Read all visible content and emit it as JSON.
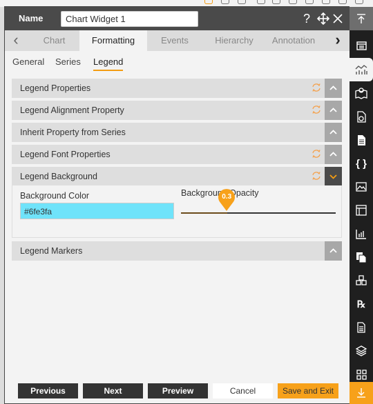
{
  "header": {
    "name_label": "Name",
    "name_value": "Chart Widget 1",
    "help_icon": "help-icon",
    "move_icon": "move-icon",
    "close_icon": "close-icon"
  },
  "tabs": {
    "prev_glyph": "‹",
    "next_glyph": "›",
    "items": [
      {
        "label": "Chart",
        "active": false
      },
      {
        "label": "Formatting",
        "active": true
      },
      {
        "label": "Events",
        "active": false
      },
      {
        "label": "Hierarchy",
        "active": false
      },
      {
        "label": "Annotation",
        "active": false
      }
    ]
  },
  "subtabs": [
    {
      "label": "General",
      "active": false
    },
    {
      "label": "Series",
      "active": false
    },
    {
      "label": "Legend",
      "active": true
    }
  ],
  "accordions": [
    {
      "title": "Legend Properties",
      "has_reset": true,
      "expanded": false
    },
    {
      "title": "Legend Alignment Property",
      "has_reset": true,
      "expanded": false
    },
    {
      "title": "Inherit Property from Series",
      "has_reset": false,
      "expanded": false
    },
    {
      "title": "Legend Font Properties",
      "has_reset": true,
      "expanded": false
    },
    {
      "title": "Legend Background",
      "has_reset": true,
      "expanded": true
    },
    {
      "title": "Legend Markers",
      "has_reset": false,
      "expanded": false
    }
  ],
  "legend_background": {
    "color_label": "Background Color",
    "color_value": "#6fe3fa",
    "opacity_label": "Background Opacity",
    "opacity_value": "0.3",
    "opacity_fraction": 0.3
  },
  "footer": {
    "previous": "Previous",
    "next": "Next",
    "preview": "Preview",
    "cancel": "Cancel",
    "save_exit": "Save and Exit"
  },
  "rail": {
    "top_icon": "collapse-up-icon",
    "items": [
      "dashboard-icon",
      "chart-icon",
      "map-icon",
      "file-chart-icon",
      "document-icon",
      "json-icon",
      "image-icon",
      "table-icon",
      "bar-chart-icon",
      "copy-icon",
      "cubes-icon",
      "rx-icon",
      "report-icon",
      "layers-icon",
      "grid-icon"
    ],
    "bottom_icon": "download-icon"
  },
  "colors": {
    "accent": "#f7a11a",
    "header_bg": "#4a4a4a",
    "color_swatch": "#6fe3fa"
  }
}
